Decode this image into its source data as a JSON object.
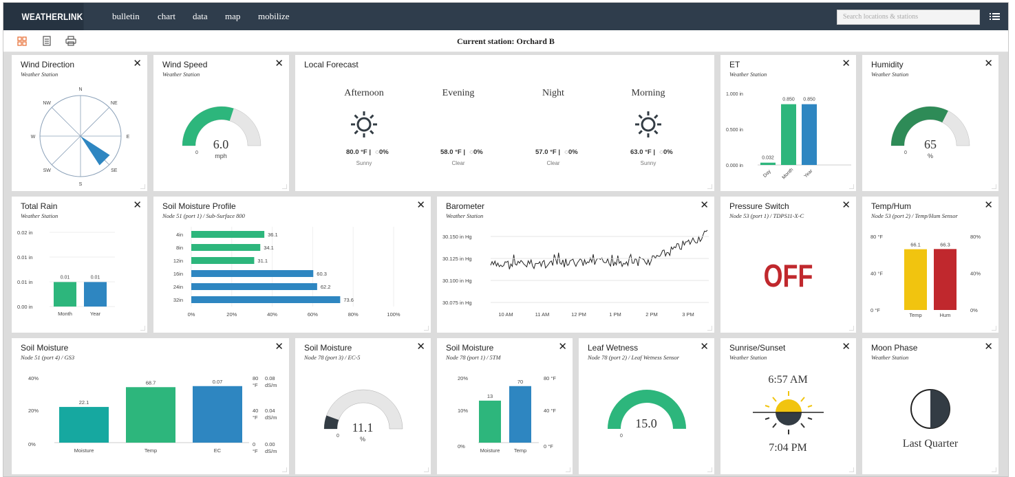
{
  "app": {
    "logo": "WEATHERLINK",
    "nav": [
      "bulletin",
      "chart",
      "data",
      "map",
      "mobilize"
    ],
    "search_placeholder": "Search locations & stations"
  },
  "station_label": "Current station: Orchard B",
  "colors": {
    "green": "#2db67c",
    "blue": "#2e86c1",
    "teal": "#16a8a0",
    "darkgreen": "#2e8b57",
    "yellow": "#f1c40f",
    "red": "#c0282d",
    "off_red": "#c0282d",
    "topbar": "#2f3d4c",
    "gray": "#e6e6e6",
    "dark": "#333c44"
  },
  "cards": {
    "wind_direction": {
      "title": "Wind Direction",
      "subtitle": "Weather Station",
      "dirs": [
        "N",
        "NE",
        "E",
        "SE",
        "S",
        "SW",
        "W",
        "NW"
      ],
      "direction_deg": 135
    },
    "wind_speed": {
      "title": "Wind Speed",
      "subtitle": "Weather Station",
      "value": "6.0",
      "unit": "mph",
      "min": "0",
      "fraction": 0.6
    },
    "forecast": {
      "title": "Local Forecast",
      "periods": [
        {
          "name": "Afternoon",
          "icon": "sun-icon",
          "temp": "80.0 °F",
          "precip": "0%",
          "cond": "Sunny"
        },
        {
          "name": "Evening",
          "icon": "moon-icon",
          "temp": "58.0 °F",
          "precip": "0%",
          "cond": "Clear"
        },
        {
          "name": "Night",
          "icon": "moon-icon",
          "temp": "57.0 °F",
          "precip": "0%",
          "cond": "Clear"
        },
        {
          "name": "Morning",
          "icon": "sun-icon",
          "temp": "63.0 °F",
          "precip": "0%",
          "cond": "Sunny"
        }
      ]
    },
    "et": {
      "title": "ET",
      "subtitle": "Weather Station",
      "yticks": [
        "1.000 in",
        "0.500 in",
        "0.000 in"
      ],
      "categories": [
        "Day",
        "Month",
        "Year"
      ],
      "values": [
        0.032,
        0.85,
        0.85
      ],
      "labels": [
        "0.032",
        "0.850",
        "0.850"
      ]
    },
    "humidity": {
      "title": "Humidity",
      "subtitle": "Weather Station",
      "value": "65",
      "unit": "%",
      "min": "0",
      "fraction": 0.65
    },
    "total_rain": {
      "title": "Total Rain",
      "subtitle": "Weather Station",
      "yticks": [
        "0.02 in",
        "0.01 in",
        "0.01 in",
        "0.00 in"
      ],
      "categories": [
        "Month",
        "Year"
      ],
      "values": [
        0.01,
        0.01
      ],
      "labels": [
        "0.01",
        "0.01"
      ]
    },
    "soil_profile": {
      "title": "Soil Moisture Profile",
      "subtitle": "Node 51 (port 1) / Sub-Surface 800",
      "depths": [
        "4in",
        "8in",
        "12in",
        "16in",
        "24in",
        "32in"
      ],
      "values": [
        36.1,
        34.1,
        31.1,
        60.3,
        62.2,
        73.6
      ],
      "labels": [
        "36.1",
        "34.1",
        "31.1",
        "60.3",
        "62.2",
        "73.6"
      ],
      "xticks": [
        "0%",
        "20%",
        "40%",
        "60%",
        "80%",
        "100%"
      ]
    },
    "barometer": {
      "title": "Barometer",
      "subtitle": "Weather Station",
      "yticks": [
        "30.150 in Hg",
        "30.125 in Hg",
        "30.100 in Hg",
        "30.075 in Hg"
      ],
      "xticks": [
        "10 AM",
        "11 AM",
        "12 PM",
        "1 PM",
        "2 PM",
        "3 PM"
      ]
    },
    "pressure_switch": {
      "title": "Pressure Switch",
      "subtitle": "Node 53 (port 1) / TDPS11-X-C",
      "state": "OFF"
    },
    "temp_hum": {
      "title": "Temp/Hum",
      "subtitle": "Node 53 (port 2) / Temp/Hum Sensor",
      "left_ticks": [
        "80 °F",
        "40 °F",
        "0 °F"
      ],
      "right_ticks": [
        "80%",
        "40%",
        "0%"
      ],
      "categories": [
        "Temp",
        "Hum"
      ],
      "values": [
        66.1,
        66.3
      ],
      "labels": [
        "66.1",
        "66.3"
      ]
    },
    "soil_moisture_1": {
      "title": "Soil Moisture",
      "subtitle": "Node 51 (port 4) / GS3",
      "left_ticks": [
        "40%",
        "20%",
        "0%"
      ],
      "right_ticks_a": [
        "80",
        "40",
        "0"
      ],
      "right_ticks_a_unit": "°F",
      "right_ticks_b": [
        "0.08",
        "0.04",
        "0.00"
      ],
      "right_ticks_b_unit": "dS/m",
      "categories": [
        "Moisture",
        "Temp",
        "EC"
      ],
      "values": [
        22.1,
        68.7,
        0.07
      ],
      "labels": [
        "22.1",
        "68.7",
        "0.07"
      ]
    },
    "soil_moisture_2": {
      "title": "Soil Moisture",
      "subtitle": "Node 78 (port 3) / EC-5",
      "value": "11.1",
      "unit": "%",
      "min": "0",
      "fraction": 0.111
    },
    "soil_moisture_3": {
      "title": "Soil Moisture",
      "subtitle": "Node 78 (port 1) / 5TM",
      "left_ticks": [
        "20%",
        "10%",
        "0%"
      ],
      "right_ticks": [
        "80 °F",
        "40 °F",
        "0 °F"
      ],
      "categories": [
        "Moisture",
        "Temp"
      ],
      "values": [
        13,
        70
      ],
      "labels": [
        "13",
        "70"
      ]
    },
    "leaf_wetness": {
      "title": "Leaf Wetness",
      "subtitle": "Node 78 (port 2) / Leaf Wetness Sensor",
      "value": "15.0",
      "min": "0",
      "fraction": 1.0
    },
    "sunrise": {
      "title": "Sunrise/Sunset",
      "subtitle": "Weather Station",
      "sunrise": "6:57 AM",
      "sunset": "7:04 PM"
    },
    "moon": {
      "title": "Moon Phase",
      "subtitle": "Weather Station",
      "phase": "Last Quarter"
    }
  }
}
